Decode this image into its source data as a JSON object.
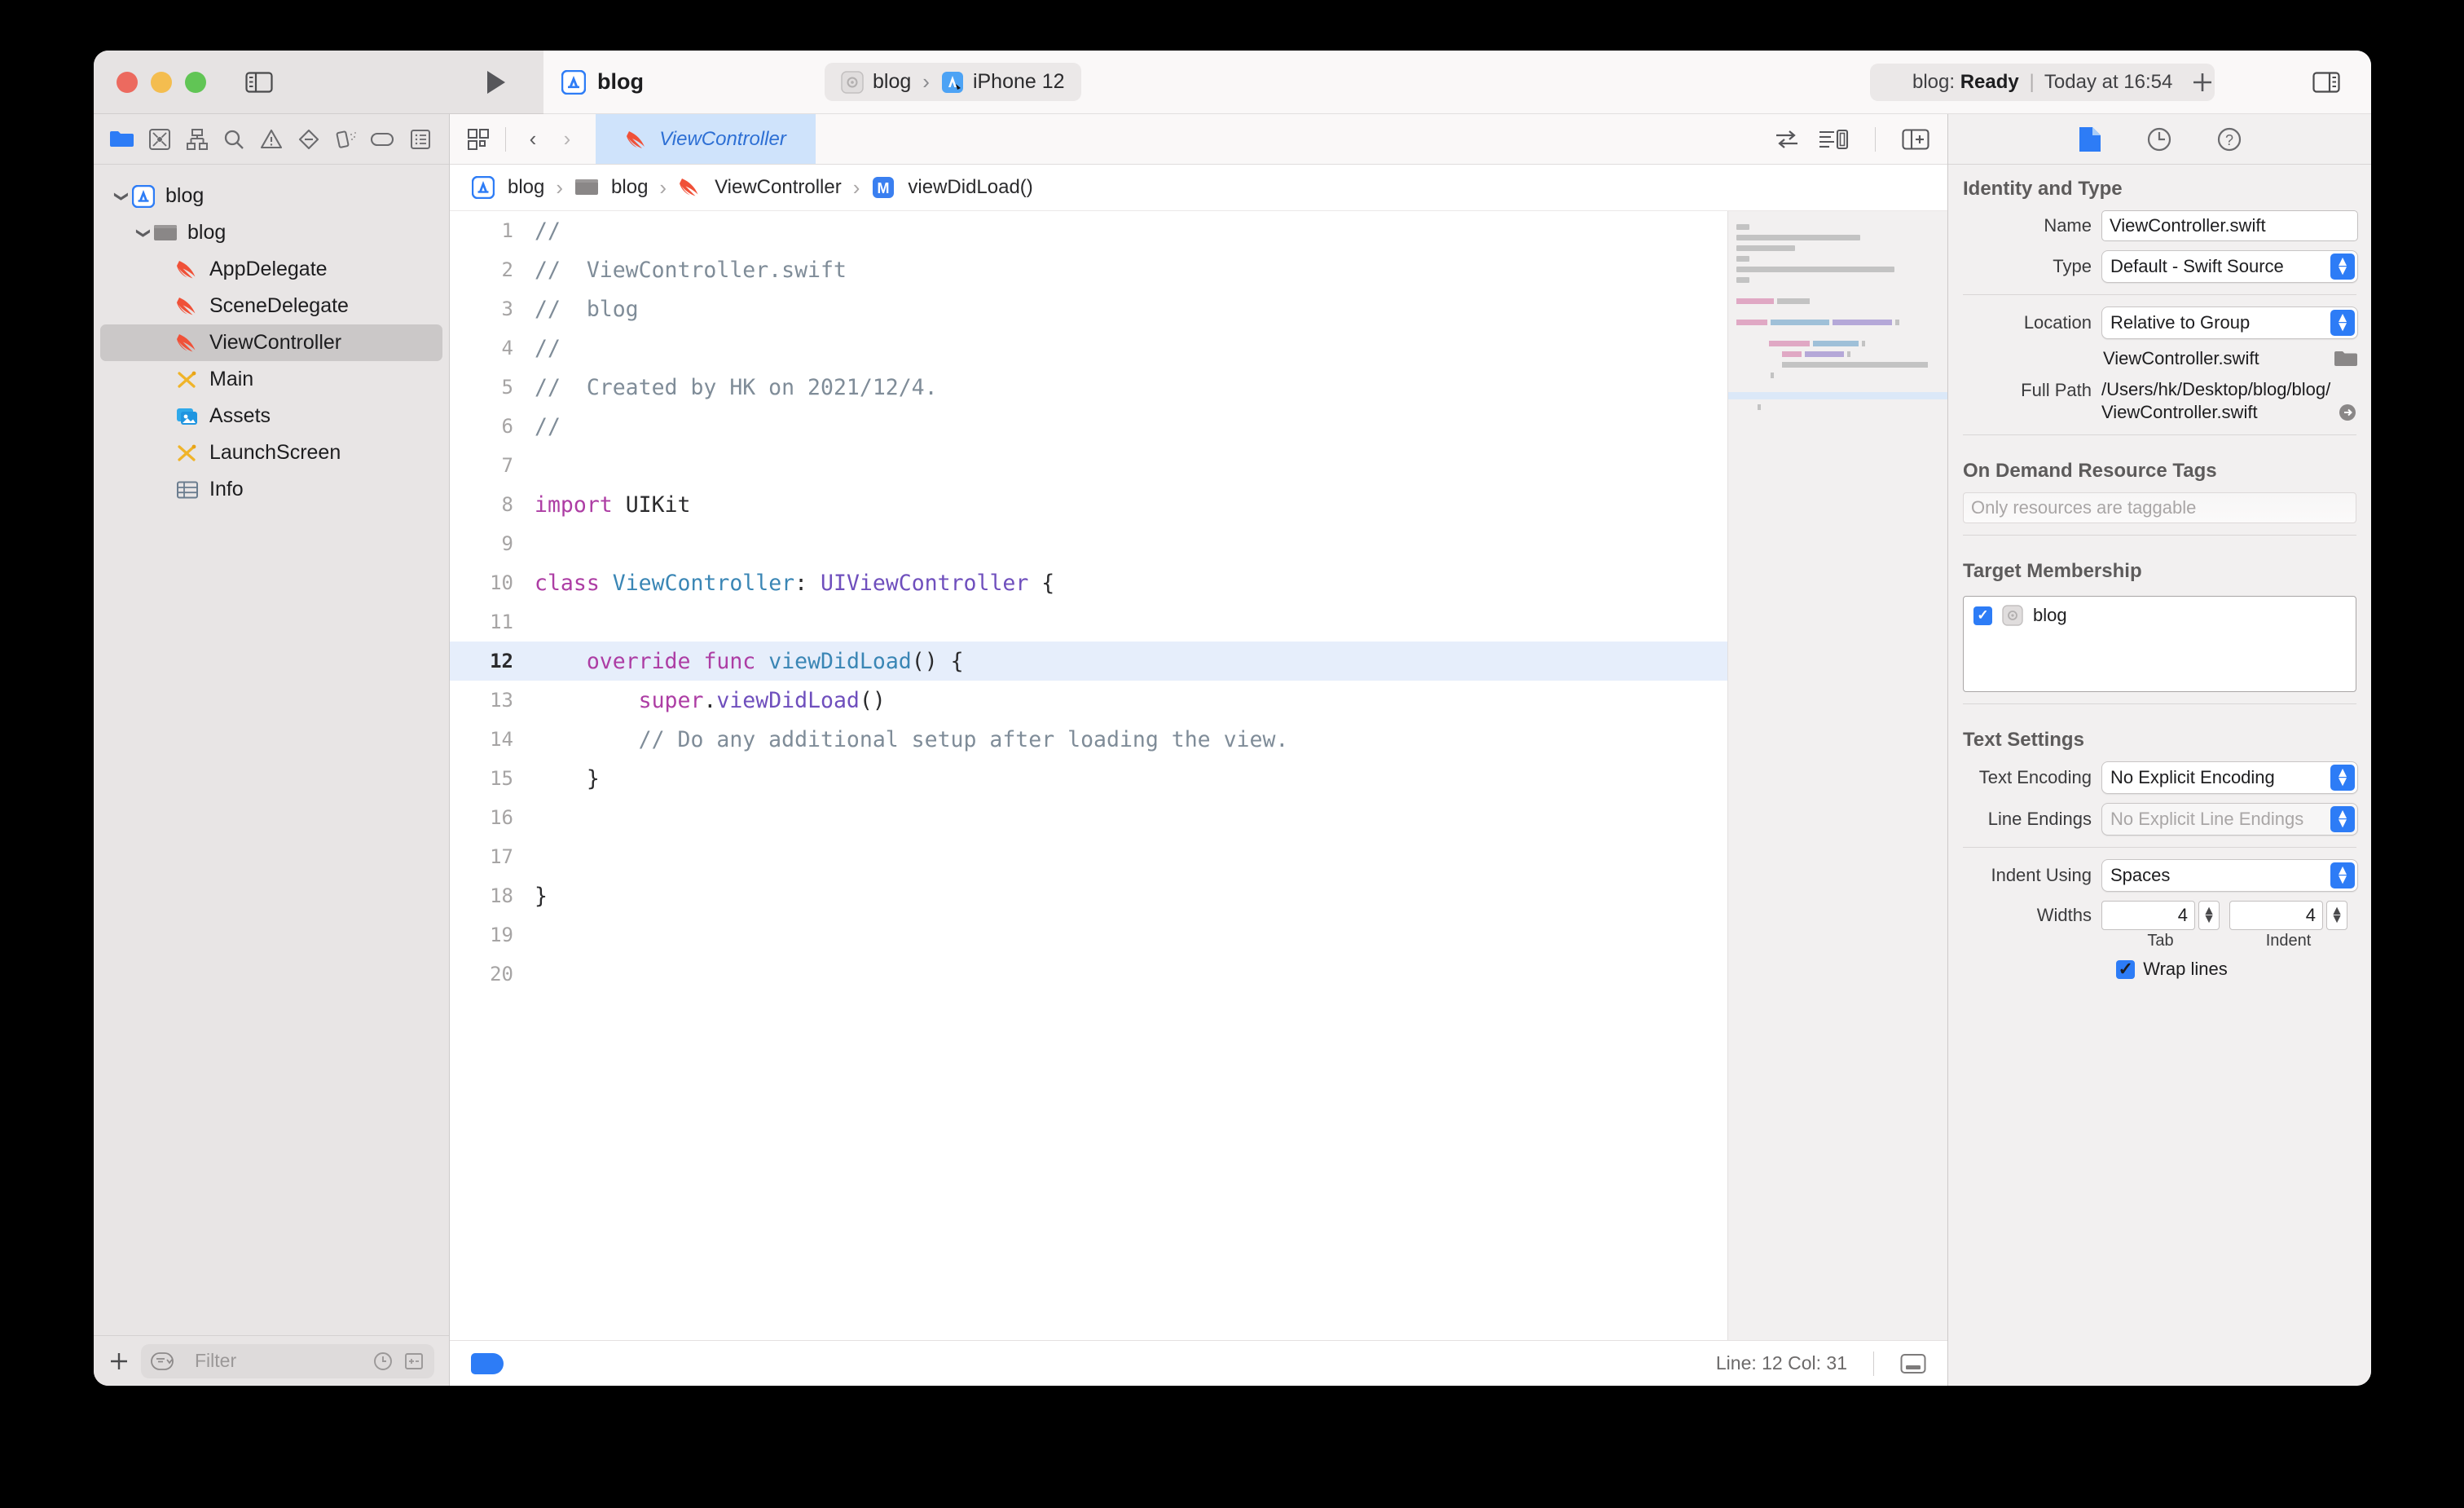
{
  "titlebar": {
    "project_name": "blog",
    "scheme": "blog",
    "destination": "iPhone 12",
    "status_prefix": "blog:",
    "status_state": "Ready",
    "status_time": "Today at 16:54",
    "status_separator": "|"
  },
  "navigator": {
    "toolbar_icons": [
      "folder-icon",
      "source-control-icon",
      "hierarchy-icon",
      "search-icon",
      "warning-icon",
      "breakpoint-icon",
      "test-icon",
      "tag-icon",
      "report-icon"
    ],
    "tree": [
      {
        "label": "blog",
        "icon": "xcode-project-icon",
        "depth": 0,
        "disclosure": "open",
        "selected": false
      },
      {
        "label": "blog",
        "icon": "folder-icon",
        "depth": 1,
        "disclosure": "open",
        "selected": false
      },
      {
        "label": "AppDelegate",
        "icon": "swift-icon",
        "depth": 2,
        "disclosure": "",
        "selected": false
      },
      {
        "label": "SceneDelegate",
        "icon": "swift-icon",
        "depth": 2,
        "disclosure": "",
        "selected": false
      },
      {
        "label": "ViewController",
        "icon": "swift-icon",
        "depth": 2,
        "disclosure": "",
        "selected": true
      },
      {
        "label": "Main",
        "icon": "storyboard-icon",
        "depth": 2,
        "disclosure": "",
        "selected": false
      },
      {
        "label": "Assets",
        "icon": "assets-icon",
        "depth": 2,
        "disclosure": "",
        "selected": false
      },
      {
        "label": "LaunchScreen",
        "icon": "storyboard-icon",
        "depth": 2,
        "disclosure": "",
        "selected": false
      },
      {
        "label": "Info",
        "icon": "plist-icon",
        "depth": 2,
        "disclosure": "",
        "selected": false
      }
    ],
    "filter_placeholder": "Filter",
    "add_button": "+"
  },
  "editor": {
    "tab_label": "ViewController",
    "breadcrumb": [
      "blog",
      "blog",
      "ViewController",
      "viewDidLoad()"
    ],
    "breadcrumb_icons": [
      "xcode-project-icon",
      "folder-icon",
      "swift-icon",
      "method-icon"
    ],
    "current_line": 12,
    "code": [
      {
        "n": 1,
        "tokens": [
          {
            "t": "//",
            "c": "c-comment"
          }
        ]
      },
      {
        "n": 2,
        "tokens": [
          {
            "t": "//  ViewController.swift",
            "c": "c-comment"
          }
        ]
      },
      {
        "n": 3,
        "tokens": [
          {
            "t": "//  blog",
            "c": "c-comment"
          }
        ]
      },
      {
        "n": 4,
        "tokens": [
          {
            "t": "//",
            "c": "c-comment"
          }
        ]
      },
      {
        "n": 5,
        "tokens": [
          {
            "t": "//  Created by HK on 2021/12/4.",
            "c": "c-comment"
          }
        ]
      },
      {
        "n": 6,
        "tokens": [
          {
            "t": "//",
            "c": "c-comment"
          }
        ]
      },
      {
        "n": 7,
        "tokens": []
      },
      {
        "n": 8,
        "tokens": [
          {
            "t": "import",
            "c": "c-kw"
          },
          {
            "t": " UIKit",
            "c": "c-plain"
          }
        ]
      },
      {
        "n": 9,
        "tokens": []
      },
      {
        "n": 10,
        "tokens": [
          {
            "t": "class",
            "c": "c-kw"
          },
          {
            "t": " ",
            "c": "c-plain"
          },
          {
            "t": "ViewController",
            "c": "c-type"
          },
          {
            "t": ": ",
            "c": "c-plain"
          },
          {
            "t": "UIViewController",
            "c": "c-proj"
          },
          {
            "t": " {",
            "c": "c-plain"
          }
        ]
      },
      {
        "n": 11,
        "tokens": []
      },
      {
        "n": 12,
        "tokens": [
          {
            "t": "    ",
            "c": "c-plain"
          },
          {
            "t": "override",
            "c": "c-kw"
          },
          {
            "t": " ",
            "c": "c-plain"
          },
          {
            "t": "func",
            "c": "c-kw"
          },
          {
            "t": " ",
            "c": "c-plain"
          },
          {
            "t": "viewDidLoad",
            "c": "c-type"
          },
          {
            "t": "() {",
            "c": "c-plain"
          }
        ]
      },
      {
        "n": 13,
        "tokens": [
          {
            "t": "        ",
            "c": "c-plain"
          },
          {
            "t": "super",
            "c": "c-kw"
          },
          {
            "t": ".",
            "c": "c-plain"
          },
          {
            "t": "viewDidLoad",
            "c": "c-proj"
          },
          {
            "t": "()",
            "c": "c-plain"
          }
        ]
      },
      {
        "n": 14,
        "tokens": [
          {
            "t": "        // Do any additional setup after loading the view.",
            "c": "c-comment"
          }
        ]
      },
      {
        "n": 15,
        "tokens": [
          {
            "t": "    }",
            "c": "c-plain"
          }
        ]
      },
      {
        "n": 16,
        "tokens": []
      },
      {
        "n": 17,
        "tokens": []
      },
      {
        "n": 18,
        "tokens": [
          {
            "t": "}",
            "c": "c-plain"
          }
        ]
      },
      {
        "n": 19,
        "tokens": []
      },
      {
        "n": 20,
        "tokens": []
      }
    ],
    "status_line": "Line: 12  Col: 31"
  },
  "inspector": {
    "tabs": [
      "file-inspector-icon",
      "history-inspector-icon",
      "quick-help-icon"
    ],
    "identity_section": {
      "title": "Identity and Type",
      "name_label": "Name",
      "name_value": "ViewController.swift",
      "type_label": "Type",
      "type_value": "Default - Swift Source",
      "location_label": "Location",
      "location_value": "Relative to Group",
      "file_name": "ViewController.swift",
      "full_path_label": "Full Path",
      "full_path_value": "/Users/hk/Desktop/blog/blog/ViewController.swift"
    },
    "odr_section": {
      "title": "On Demand Resource Tags",
      "placeholder": "Only resources are taggable"
    },
    "target_section": {
      "title": "Target Membership",
      "items": [
        {
          "label": "blog",
          "checked": true
        }
      ]
    },
    "text_section": {
      "title": "Text Settings",
      "encoding_label": "Text Encoding",
      "encoding_value": "No Explicit Encoding",
      "line_endings_label": "Line Endings",
      "line_endings_value": "No Explicit Line Endings",
      "indent_label": "Indent Using",
      "indent_value": "Spaces",
      "widths_label": "Widths",
      "tab_width": "4",
      "indent_width": "4",
      "tab_sublabel": "Tab",
      "indent_sublabel": "Indent",
      "wrap_label": "Wrap lines",
      "wrap_checked": true
    }
  },
  "colors": {
    "accent": "#2d7cf6",
    "selection": "#cbc8c8",
    "tab_active": "#cfe3fb",
    "current_line": "#e6eefb",
    "swift_orange": "#f05138",
    "comment": "#7f8c98",
    "keyword": "#ad3da4",
    "type": "#3a86b5"
  }
}
